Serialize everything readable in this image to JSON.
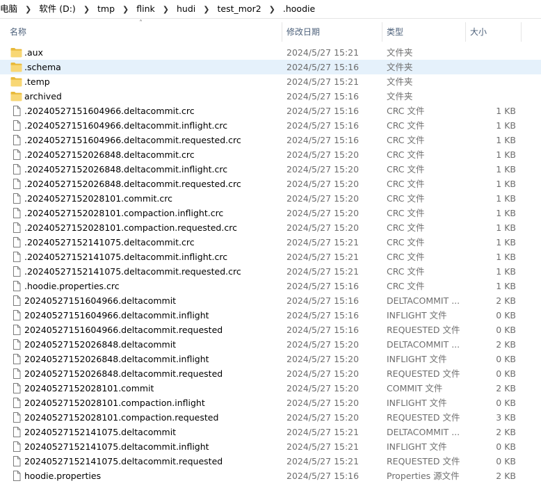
{
  "breadcrumb": [
    "电脑",
    "软件 (D:)",
    "tmp",
    "flink",
    "hudi",
    "test_mor2",
    ".hoodie"
  ],
  "columns": {
    "name": "名称",
    "date": "修改日期",
    "type": "类型",
    "size": "大小"
  },
  "colors": {
    "selected_row": "#e5f1fb",
    "folder": "#f8d775",
    "header_text": "#4c607a",
    "meta_text": "#6d6d6d"
  },
  "files": [
    {
      "name": ".aux",
      "date": "2024/5/27 15:21",
      "type": "文件夹",
      "size": "",
      "icon": "folder-icon",
      "selected": false
    },
    {
      "name": ".schema",
      "date": "2024/5/27 15:16",
      "type": "文件夹",
      "size": "",
      "icon": "folder-icon",
      "selected": true
    },
    {
      "name": ".temp",
      "date": "2024/5/27 15:21",
      "type": "文件夹",
      "size": "",
      "icon": "folder-icon",
      "selected": false
    },
    {
      "name": "archived",
      "date": "2024/5/27 15:16",
      "type": "文件夹",
      "size": "",
      "icon": "folder-icon",
      "selected": false
    },
    {
      "name": ".20240527151604966.deltacommit.crc",
      "date": "2024/5/27 15:16",
      "type": "CRC 文件",
      "size": "1 KB",
      "icon": "file-icon",
      "selected": false
    },
    {
      "name": ".20240527151604966.deltacommit.inflight.crc",
      "date": "2024/5/27 15:16",
      "type": "CRC 文件",
      "size": "1 KB",
      "icon": "file-icon",
      "selected": false
    },
    {
      "name": ".20240527151604966.deltacommit.requested.crc",
      "date": "2024/5/27 15:16",
      "type": "CRC 文件",
      "size": "1 KB",
      "icon": "file-icon",
      "selected": false
    },
    {
      "name": ".20240527152026848.deltacommit.crc",
      "date": "2024/5/27 15:20",
      "type": "CRC 文件",
      "size": "1 KB",
      "icon": "file-icon",
      "selected": false
    },
    {
      "name": ".20240527152026848.deltacommit.inflight.crc",
      "date": "2024/5/27 15:20",
      "type": "CRC 文件",
      "size": "1 KB",
      "icon": "file-icon",
      "selected": false
    },
    {
      "name": ".20240527152026848.deltacommit.requested.crc",
      "date": "2024/5/27 15:20",
      "type": "CRC 文件",
      "size": "1 KB",
      "icon": "file-icon",
      "selected": false
    },
    {
      "name": ".20240527152028101.commit.crc",
      "date": "2024/5/27 15:20",
      "type": "CRC 文件",
      "size": "1 KB",
      "icon": "file-icon",
      "selected": false
    },
    {
      "name": ".20240527152028101.compaction.inflight.crc",
      "date": "2024/5/27 15:20",
      "type": "CRC 文件",
      "size": "1 KB",
      "icon": "file-icon",
      "selected": false
    },
    {
      "name": ".20240527152028101.compaction.requested.crc",
      "date": "2024/5/27 15:20",
      "type": "CRC 文件",
      "size": "1 KB",
      "icon": "file-icon",
      "selected": false
    },
    {
      "name": ".20240527152141075.deltacommit.crc",
      "date": "2024/5/27 15:21",
      "type": "CRC 文件",
      "size": "1 KB",
      "icon": "file-icon",
      "selected": false
    },
    {
      "name": ".20240527152141075.deltacommit.inflight.crc",
      "date": "2024/5/27 15:21",
      "type": "CRC 文件",
      "size": "1 KB",
      "icon": "file-icon",
      "selected": false
    },
    {
      "name": ".20240527152141075.deltacommit.requested.crc",
      "date": "2024/5/27 15:21",
      "type": "CRC 文件",
      "size": "1 KB",
      "icon": "file-icon",
      "selected": false
    },
    {
      "name": ".hoodie.properties.crc",
      "date": "2024/5/27 15:16",
      "type": "CRC 文件",
      "size": "1 KB",
      "icon": "file-icon",
      "selected": false
    },
    {
      "name": "20240527151604966.deltacommit",
      "date": "2024/5/27 15:16",
      "type": "DELTACOMMIT ...",
      "size": "2 KB",
      "icon": "file-icon",
      "selected": false
    },
    {
      "name": "20240527151604966.deltacommit.inflight",
      "date": "2024/5/27 15:16",
      "type": "INFLIGHT 文件",
      "size": "0 KB",
      "icon": "file-icon",
      "selected": false
    },
    {
      "name": "20240527151604966.deltacommit.requested",
      "date": "2024/5/27 15:16",
      "type": "REQUESTED 文件",
      "size": "0 KB",
      "icon": "file-icon",
      "selected": false
    },
    {
      "name": "20240527152026848.deltacommit",
      "date": "2024/5/27 15:20",
      "type": "DELTACOMMIT ...",
      "size": "2 KB",
      "icon": "file-icon",
      "selected": false
    },
    {
      "name": "20240527152026848.deltacommit.inflight",
      "date": "2024/5/27 15:20",
      "type": "INFLIGHT 文件",
      "size": "0 KB",
      "icon": "file-icon",
      "selected": false
    },
    {
      "name": "20240527152026848.deltacommit.requested",
      "date": "2024/5/27 15:20",
      "type": "REQUESTED 文件",
      "size": "0 KB",
      "icon": "file-icon",
      "selected": false
    },
    {
      "name": "20240527152028101.commit",
      "date": "2024/5/27 15:20",
      "type": "COMMIT 文件",
      "size": "2 KB",
      "icon": "file-icon",
      "selected": false
    },
    {
      "name": "20240527152028101.compaction.inflight",
      "date": "2024/5/27 15:20",
      "type": "INFLIGHT 文件",
      "size": "0 KB",
      "icon": "file-icon",
      "selected": false
    },
    {
      "name": "20240527152028101.compaction.requested",
      "date": "2024/5/27 15:20",
      "type": "REQUESTED 文件",
      "size": "3 KB",
      "icon": "file-icon",
      "selected": false
    },
    {
      "name": "20240527152141075.deltacommit",
      "date": "2024/5/27 15:21",
      "type": "DELTACOMMIT ...",
      "size": "2 KB",
      "icon": "file-icon",
      "selected": false
    },
    {
      "name": "20240527152141075.deltacommit.inflight",
      "date": "2024/5/27 15:21",
      "type": "INFLIGHT 文件",
      "size": "0 KB",
      "icon": "file-icon",
      "selected": false
    },
    {
      "name": "20240527152141075.deltacommit.requested",
      "date": "2024/5/27 15:21",
      "type": "REQUESTED 文件",
      "size": "0 KB",
      "icon": "file-icon",
      "selected": false
    },
    {
      "name": "hoodie.properties",
      "date": "2024/5/27 15:16",
      "type": "Properties 源文件",
      "size": "2 KB",
      "icon": "file-icon",
      "selected": false
    }
  ]
}
